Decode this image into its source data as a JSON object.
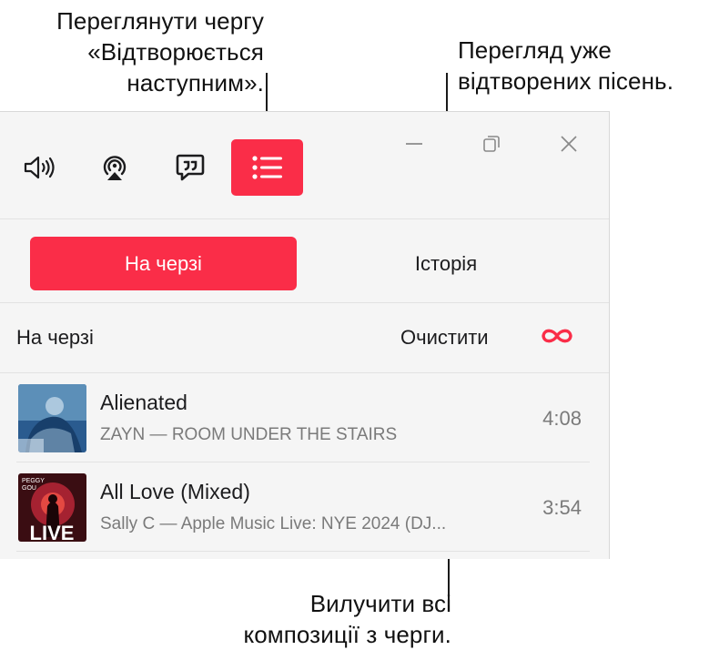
{
  "callouts": {
    "queue_line1": "Переглянути чергу",
    "queue_line2": "«Відтворюється",
    "queue_line3": "наступним».",
    "history_line1": "Перегляд уже",
    "history_line2": "відтворених пісень.",
    "clear_line1": "Вилучити всі",
    "clear_line2": "композиції з черги."
  },
  "toolbar": {
    "icons": [
      "volume-icon",
      "airplay-icon",
      "lyrics-icon",
      "queue-list-icon"
    ],
    "accent": "#fa2d48"
  },
  "segmented": {
    "queue_label": "На черзі",
    "history_label": "Історія"
  },
  "queue_header": {
    "title": "На черзі",
    "clear_label": "Очистити",
    "autoplay_icon": "infinity-icon"
  },
  "tracks": [
    {
      "title": "Alienated",
      "subtitle": "ZAYN — ROOM UNDER THE STAIRS",
      "duration": "4:08"
    },
    {
      "title": "All Love (Mixed)",
      "subtitle": "Sally C — Apple Music Live: NYE 2024 (DJ...",
      "duration": "3:54",
      "art_label": "LIVE"
    }
  ]
}
